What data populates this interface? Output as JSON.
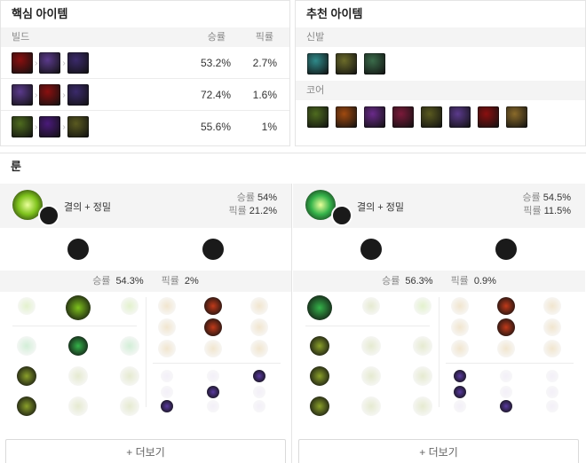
{
  "core": {
    "title": "핵심 아이템",
    "header": {
      "build": "빌드",
      "winrate": "승률",
      "pickrate": "픽률"
    },
    "rows": [
      {
        "winrate": "53.2%",
        "pickrate": "2.7%",
        "items": [
          "crimson-blade-item",
          "purple-shard-item",
          "dark-violet-item"
        ],
        "colors": [
          "#8a1010",
          "#5b3a8c",
          "#3b2a6b"
        ]
      },
      {
        "winrate": "72.4%",
        "pickrate": "1.6%",
        "items": [
          "purple-shard-item",
          "crimson-blade-item",
          "dark-violet-item"
        ],
        "colors": [
          "#5b3a8c",
          "#8a1010",
          "#3b2a6b"
        ]
      },
      {
        "winrate": "55.6%",
        "pickrate": "1%",
        "items": [
          "green-armor-item",
          "void-hood-item",
          "bramble-item"
        ],
        "colors": [
          "#4e6b1f",
          "#4a1a7a",
          "#5a5a20"
        ]
      }
    ]
  },
  "recommended": {
    "title": "추천 아이템",
    "boots_label": "신발",
    "core_label": "코어",
    "boots": [
      {
        "icon": "teal-boots-item",
        "color": "#2f8a8a"
      },
      {
        "icon": "olive-boots-item",
        "color": "#6b6b2a"
      },
      {
        "icon": "winged-boots-item",
        "color": "#3a6b4a"
      }
    ],
    "core_items": [
      {
        "icon": "green-armor-item",
        "color": "#4e6b1f"
      },
      {
        "icon": "flame-item",
        "color": "#a04a10"
      },
      {
        "icon": "violet-mask-item",
        "color": "#6a2a8a"
      },
      {
        "icon": "ruby-gauntlet-item",
        "color": "#7a1a3a"
      },
      {
        "icon": "bramble-item",
        "color": "#5a5a20"
      },
      {
        "icon": "purple-shard-item",
        "color": "#5b3a8c"
      },
      {
        "icon": "crimson-blade-item",
        "color": "#8a1010"
      },
      {
        "icon": "golden-armor-item",
        "color": "#8a6a2a"
      }
    ]
  },
  "runes": {
    "title": "룬",
    "more_label": "+ 더보기",
    "winrate_label": "승률",
    "pickrate_label": "픽률",
    "pages": [
      {
        "name": "결의 + 정밀",
        "winrate": "54%",
        "pickrate": "21.2%",
        "detail_winrate": "54.3%",
        "detail_pickrate": "2%",
        "keystone_color": "#7ec21c"
      },
      {
        "name": "결의 + 정밀",
        "winrate": "54.5%",
        "pickrate": "11.5%",
        "detail_winrate": "56.3%",
        "detail_pickrate": "0.9%",
        "keystone_color": "#35b34a"
      }
    ]
  }
}
